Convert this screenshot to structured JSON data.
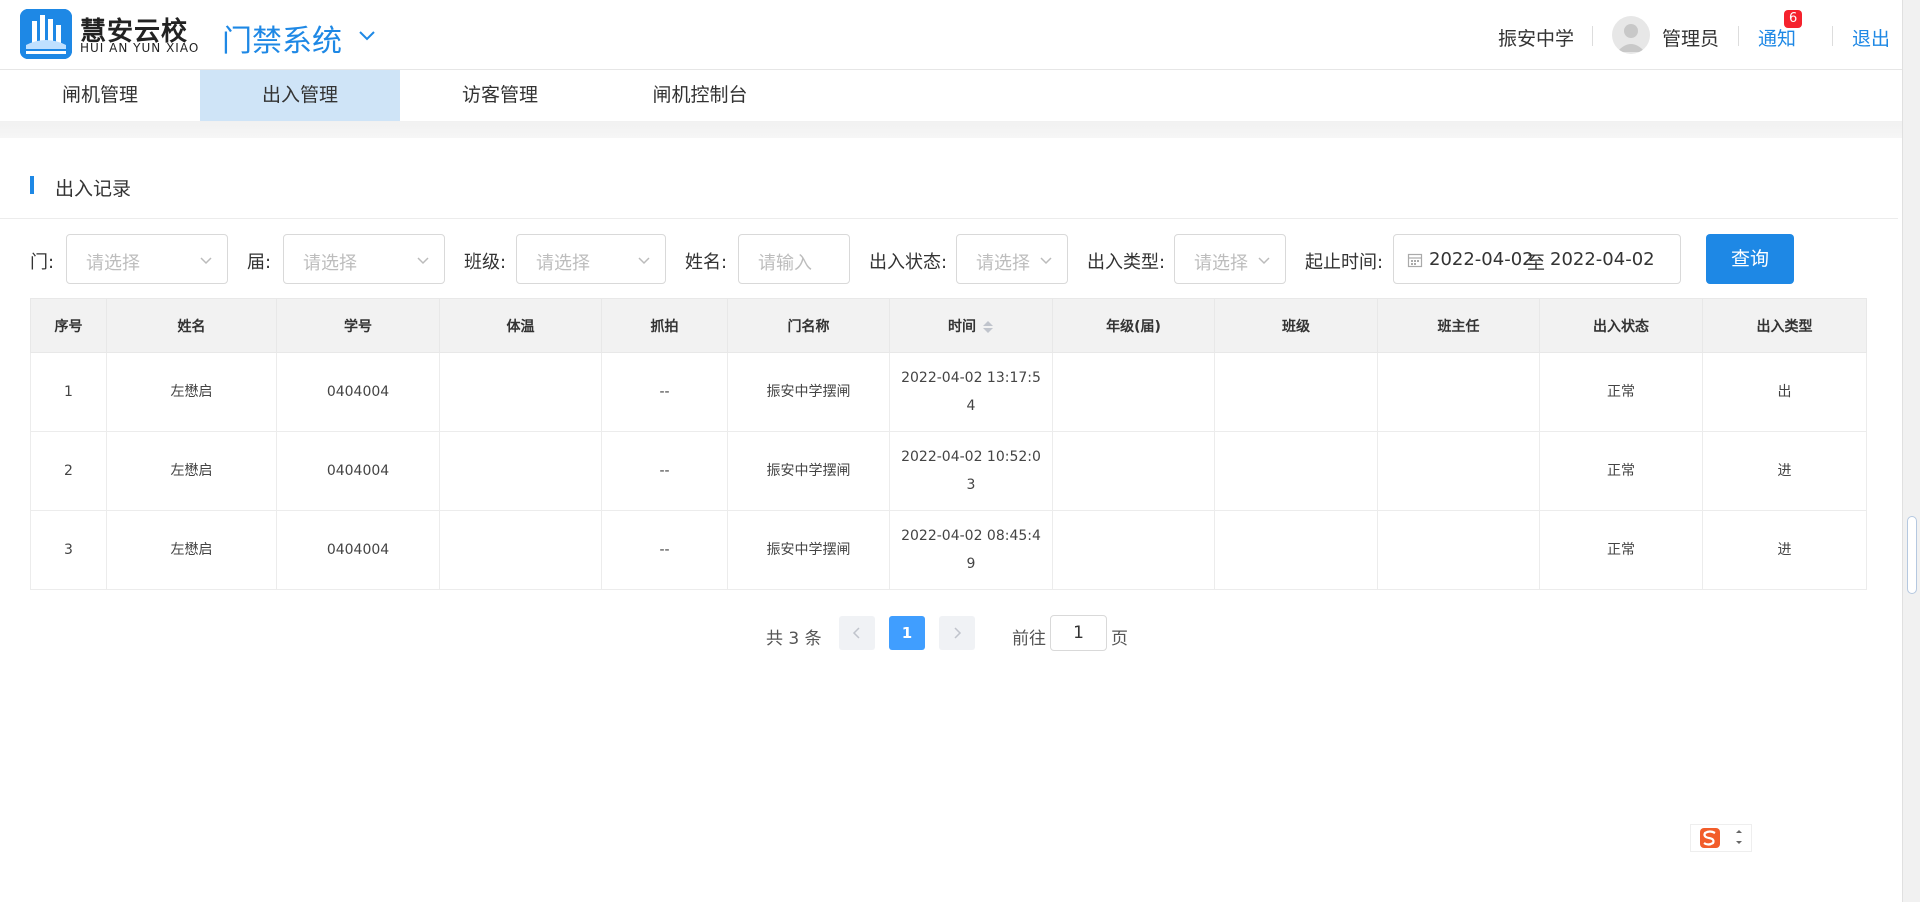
{
  "header": {
    "brand_cn": "慧安云校",
    "brand_en": "HUI AN YUN XIAO",
    "system_title": "门禁系统",
    "school": "振安中学",
    "user": "管理员",
    "notify_label": "通知",
    "notify_count": "6",
    "logout_label": "退出",
    "icons": {
      "logo": "school-logo-icon",
      "chevron": "chevron-down-icon",
      "avatar": "user-avatar-icon"
    },
    "accent_color": "#1e88e5"
  },
  "nav": {
    "tabs": [
      {
        "label": "闸机管理",
        "active": false
      },
      {
        "label": "出入管理",
        "active": true
      },
      {
        "label": "访客管理",
        "active": false
      },
      {
        "label": "闸机控制台",
        "active": false
      }
    ]
  },
  "section": {
    "title": "出入记录"
  },
  "filters": {
    "door_label": "门:",
    "door_placeholder": "请选择",
    "grade_label": "届:",
    "grade_placeholder": "请选择",
    "class_label": "班级:",
    "class_placeholder": "请选择",
    "name_label": "姓名:",
    "name_placeholder": "请输入",
    "status_label": "出入状态:",
    "status_placeholder": "请选择",
    "type_label": "出入类型:",
    "type_placeholder": "请选择",
    "time_label": "起止时间:",
    "date_start": "2022-04-02",
    "date_sep": "至",
    "date_end": "2022-04-02",
    "query_label": "查询"
  },
  "table": {
    "headers": [
      "序号",
      "姓名",
      "学号",
      "体温",
      "抓拍",
      "门名称",
      "时间",
      "年级(届)",
      "班级",
      "班主任",
      "出入状态",
      "出入类型"
    ],
    "rows": [
      [
        "1",
        "左懋启",
        "0404004",
        "",
        "--",
        "振安中学摆闸",
        "2022-04-02 13:17:54",
        "",
        "",
        "",
        "正常",
        "出"
      ],
      [
        "2",
        "左懋启",
        "0404004",
        "",
        "--",
        "振安中学摆闸",
        "2022-04-02 10:52:03",
        "",
        "",
        "",
        "正常",
        "进"
      ],
      [
        "3",
        "左懋启",
        "0404004",
        "",
        "--",
        "振安中学摆闸",
        "2022-04-02 08:45:49",
        "",
        "",
        "",
        "正常",
        "进"
      ]
    ]
  },
  "pagination": {
    "total_text": "共 3 条",
    "current_page": "1",
    "goto_label": "前往",
    "goto_value": "1",
    "page_suffix": "页"
  }
}
